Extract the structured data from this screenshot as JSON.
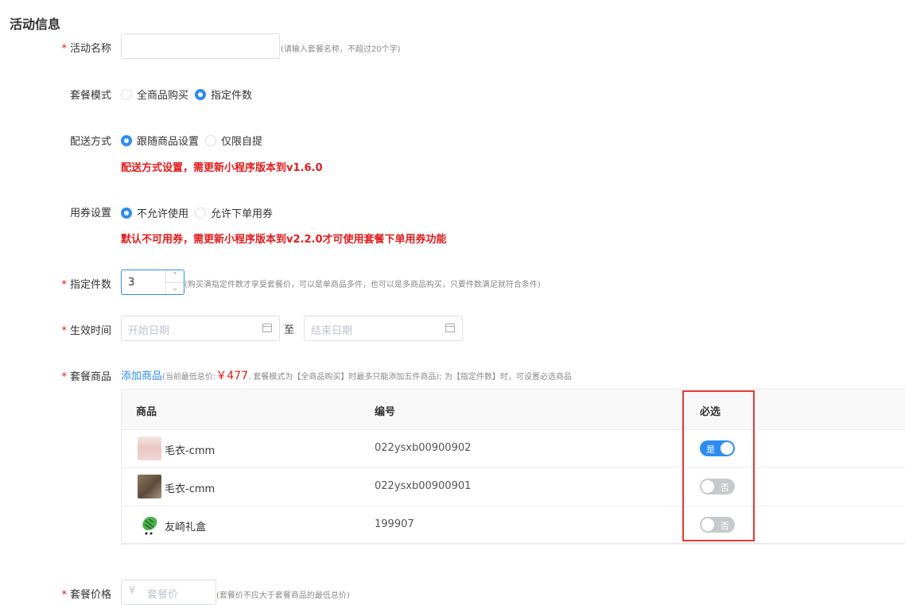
{
  "section_title": "活动信息",
  "form": {
    "name": {
      "label": "活动名称",
      "required": true,
      "value": "",
      "hint": "(请输入套餐名称，不超过20个字)"
    },
    "mode": {
      "label": "套餐模式",
      "options": [
        "全商品购买",
        "指定件数"
      ],
      "selected": 1
    },
    "delivery": {
      "label": "配送方式",
      "options": [
        "跟随商品设置",
        "仅限自提"
      ],
      "selected": 0,
      "warning": "配送方式设置，需更新小程序版本到v1.6.0"
    },
    "coupon": {
      "label": "用券设置",
      "options": [
        "不允许使用",
        "允许下单用券"
      ],
      "selected": 0,
      "warning": "默认不可用券，需更新小程序版本到v2.2.0才可使用套餐下单用券功能"
    },
    "count": {
      "label": "指定件数",
      "required": true,
      "value": "3",
      "up": "⌃",
      "down": "⌄",
      "hint": "(购买满指定件数才享受套餐价，可以是单商品多件，也可以是多商品购买，只要件数满足就符合条件)"
    },
    "time": {
      "label": "生效时间",
      "required": true,
      "start_placeholder": "开始日期",
      "separator": "至",
      "end_placeholder": "结束日期"
    },
    "goods": {
      "label": "套餐商品",
      "required": true,
      "add_link": "添加商品",
      "hint_prefix": "(当前最低总价:",
      "min_price": "￥477",
      "hint_suffix": ". 套餐模式为【全商品购买】时最多只能添加五件商品); 为【指定件数】时，可设置必选商品",
      "columns": [
        "商品",
        "编号",
        "必选"
      ],
      "rows": [
        {
          "name": "毛衣-cmm",
          "code": "022ysxb00900902",
          "required": true,
          "switch_text": "是"
        },
        {
          "name": "毛衣-cmm",
          "code": "022ysxb00900901",
          "required": false,
          "switch_text": "否"
        },
        {
          "name": "友崎礼盒",
          "code": "199907",
          "required": false,
          "switch_text": "否"
        }
      ]
    },
    "price": {
      "label": "套餐价格",
      "required": true,
      "symbol": "¥",
      "placeholder": "套餐价",
      "hint": "(套餐价不应大于套餐商品的最低总价)"
    }
  },
  "colors": {
    "accent": "#2d8cf0",
    "warning": "#e01c1c",
    "highlight": "#e53935"
  }
}
